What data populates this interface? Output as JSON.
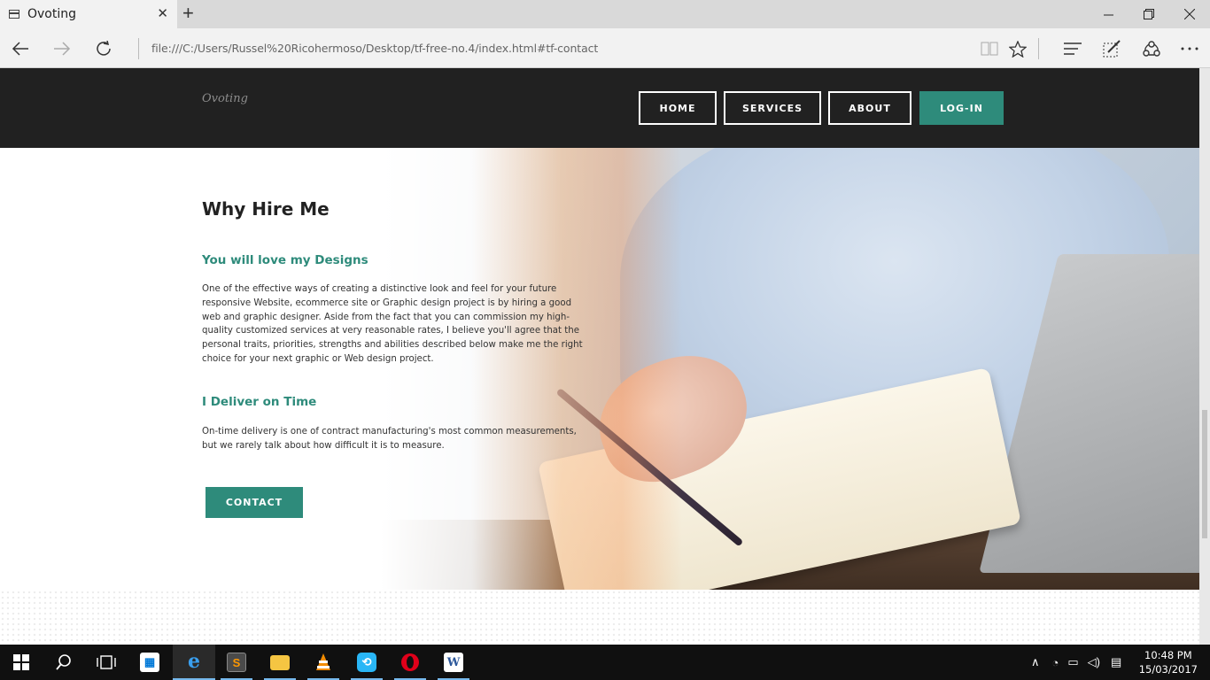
{
  "browser": {
    "tab_title": "Ovoting",
    "tab_close": "✕",
    "new_tab": "+",
    "url": "file:///C:/Users/Russel%20Ricohermoso/Desktop/tf-free-no.4/index.html#tf-contact",
    "icons": [
      "back-icon",
      "forward-icon",
      "refresh-icon",
      "reading-view-icon",
      "favorite-star-icon",
      "hub-icon",
      "web-note-icon",
      "share-icon",
      "more-icon"
    ]
  },
  "site": {
    "logo": "Ovoting",
    "nav": [
      "HOME",
      "SERVICES",
      "ABOUT",
      "LOG-IN"
    ],
    "accent": "#2e8b7b"
  },
  "section": {
    "title": "Why Hire Me",
    "sub1": "You will love my Designs",
    "para1": "One of the effective ways of creating a distinctive look and feel for your future responsive Website, ecommerce site or Graphic design project is by hiring a good web and graphic designer. Aside from the fact that you can commission my high-quality customized services at very reasonable rates, I believe you'll agree that the personal traits, priorities, strengths and abilities described below make me the right choice for your next graphic or Web design project.",
    "sub2": "I Deliver on Time",
    "para2": "On-time delivery is one of contract manufacturing's most common measurements, but we rarely talk about how difficult it is to measure.",
    "button": "CONTACT"
  },
  "taskbar": {
    "apps": [
      "start-icon",
      "search-icon",
      "task-view-icon",
      "store-icon",
      "edge-icon",
      "sublime-icon",
      "file-explorer-icon",
      "vlc-icon",
      "app-icon",
      "opera-icon",
      "word-icon"
    ],
    "time": "10:48 PM",
    "date": "15/03/2017"
  }
}
